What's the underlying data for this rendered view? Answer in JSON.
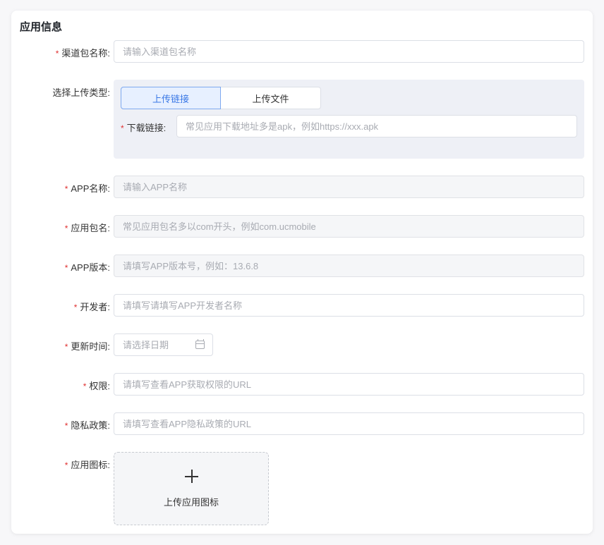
{
  "section_title": "应用信息",
  "required_mark": "*",
  "channel_pkg": {
    "label": "渠道包名称:",
    "placeholder": "请输入渠道包名称"
  },
  "upload_type": {
    "label": "选择上传类型:",
    "options": [
      "上传链接",
      "上传文件"
    ],
    "selected": "上传链接",
    "download_link": {
      "label": "下载链接:",
      "placeholder": "常见应用下载地址多是apk，例如https://xxx.apk"
    }
  },
  "app_name": {
    "label": "APP名称:",
    "placeholder": "请输入APP名称"
  },
  "app_pkg": {
    "label": "应用包名:",
    "placeholder": "常见应用包名多以com开头，例如com.ucmobile"
  },
  "app_version": {
    "label": "APP版本:",
    "placeholder": "请填写APP版本号，例如：13.6.8"
  },
  "developer": {
    "label": "开发者:",
    "placeholder": "请填写请填写APP开发者名称"
  },
  "update_time": {
    "label": "更新时间:",
    "placeholder": "请选择日期",
    "icon": "calendar-icon"
  },
  "permissions": {
    "label": "权限:",
    "placeholder": "请填写查看APP获取权限的URL"
  },
  "privacy": {
    "label": "隐私政策:",
    "placeholder": "请填写查看APP隐私政策的URL"
  },
  "app_icon": {
    "label": "应用图标:",
    "upload_text": "上传应用图标",
    "icon": "plus-icon"
  },
  "colors": {
    "required": "#e03131",
    "active_tab_bg": "#e7f0ff",
    "active_tab_text": "#3a78e6",
    "panel_bg": "#eef0f6"
  }
}
